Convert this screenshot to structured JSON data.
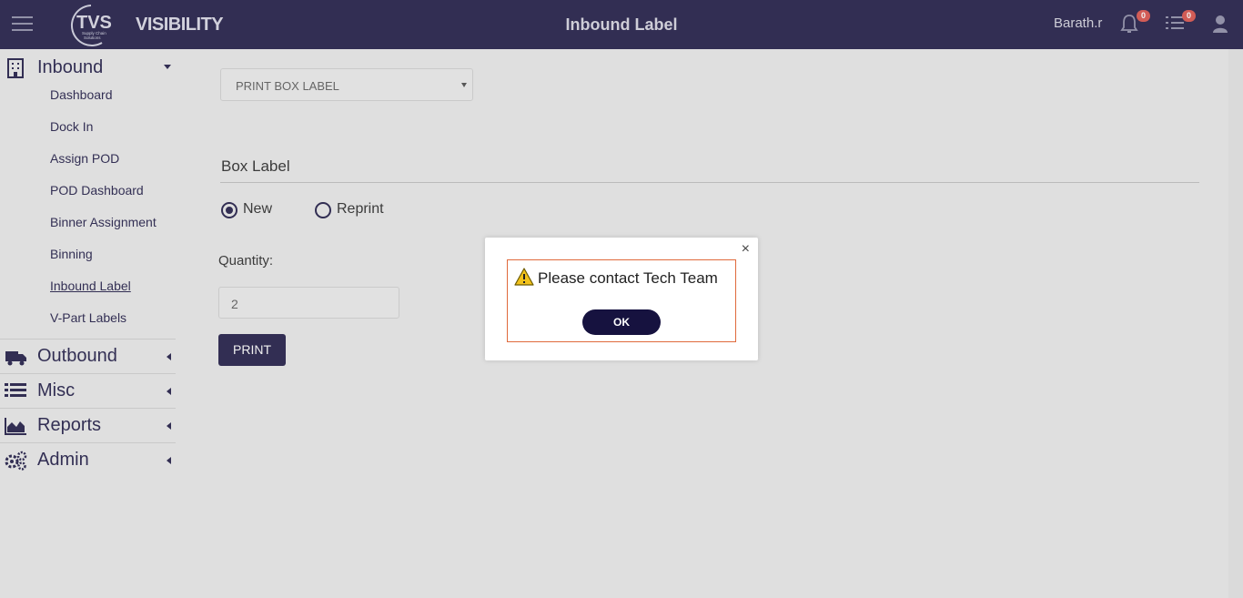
{
  "header": {
    "app_name": "VISIBILITY",
    "logo_text": "TVS",
    "logo_subtext": "Supply Chain Solutions",
    "page_title": "Inbound Label",
    "username": "Barath.r",
    "notifications_count": "0",
    "tasks_count": "0",
    "icons": [
      "menu-icon",
      "bell-icon",
      "list-icon",
      "user-icon"
    ]
  },
  "sidebar": {
    "groups": [
      {
        "label": "Inbound",
        "icon": "building-icon",
        "expanded": true
      },
      {
        "label": "Outbound",
        "icon": "truck-icon",
        "expanded": false
      },
      {
        "label": "Misc",
        "icon": "list-icon",
        "expanded": false
      },
      {
        "label": "Reports",
        "icon": "area-chart-icon",
        "expanded": false
      },
      {
        "label": "Admin",
        "icon": "gears-icon",
        "expanded": false
      }
    ],
    "inbound_items": [
      "Dashboard",
      "Dock In",
      "Assign POD",
      "POD Dashboard",
      "Binner Assignment",
      "Binning",
      "Inbound Label",
      "V-Part Labels"
    ],
    "active_item": "Inbound Label"
  },
  "main": {
    "label_type_select": "PRINT BOX LABEL",
    "section_title": "Box Label",
    "radio_new": "New",
    "radio_reprint": "Reprint",
    "selected_radio": "New",
    "quantity_label": "Quantity:",
    "quantity_value": "2",
    "print_button": "PRINT"
  },
  "modal": {
    "close": "×",
    "message": "Please contact Tech Team",
    "ok_button": "OK"
  },
  "colors": {
    "primary": "#16123f",
    "badge": "#d94a43",
    "alert_border": "#e06a3c",
    "warning": "#f2c21b"
  }
}
